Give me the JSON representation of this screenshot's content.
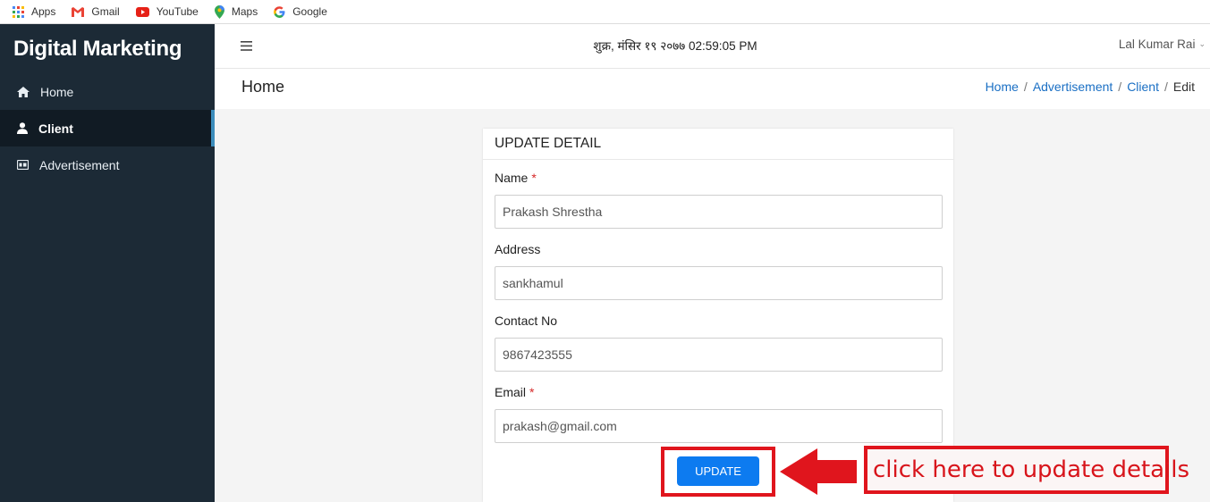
{
  "bookmarks": [
    {
      "label": "Apps",
      "icon": "apps-grid-icon"
    },
    {
      "label": "Gmail",
      "icon": "gmail-icon"
    },
    {
      "label": "YouTube",
      "icon": "youtube-icon"
    },
    {
      "label": "Maps",
      "icon": "maps-pin-icon"
    },
    {
      "label": "Google",
      "icon": "google-icon"
    }
  ],
  "sidebar": {
    "brand": "Digital Marketing",
    "items": [
      {
        "label": "Home",
        "icon": "home-icon",
        "active": false
      },
      {
        "label": "Client",
        "icon": "user-icon",
        "active": true
      },
      {
        "label": "Advertisement",
        "icon": "ad-icon",
        "active": false
      }
    ]
  },
  "topbar": {
    "datetime": "शुक्र, मंसिर १९ २०७७ 02:59:05 PM",
    "user": "Lal Kumar Rai"
  },
  "content_header": {
    "title": "Home",
    "breadcrumb": [
      "Home",
      "Advertisement",
      "Client",
      "Edit"
    ]
  },
  "form": {
    "title": "UPDATE DETAIL",
    "fields": [
      {
        "label": "Name",
        "required": true,
        "value": "Prakash Shrestha"
      },
      {
        "label": "Address",
        "required": false,
        "value": "sankhamul"
      },
      {
        "label": "Contact No",
        "required": false,
        "value": "9867423555"
      },
      {
        "label": "Email",
        "required": true,
        "value": "prakash@gmail.com"
      }
    ],
    "submit_label": "UPDATE"
  },
  "annotation": {
    "callout": "click here to update details"
  },
  "colors": {
    "sidebar_bg": "#1c2a36",
    "sidebar_active_bg": "#111b24",
    "accent_blue": "#0d7bf0",
    "link_blue": "#1a6fc4",
    "annotation_red": "#e0151d"
  }
}
